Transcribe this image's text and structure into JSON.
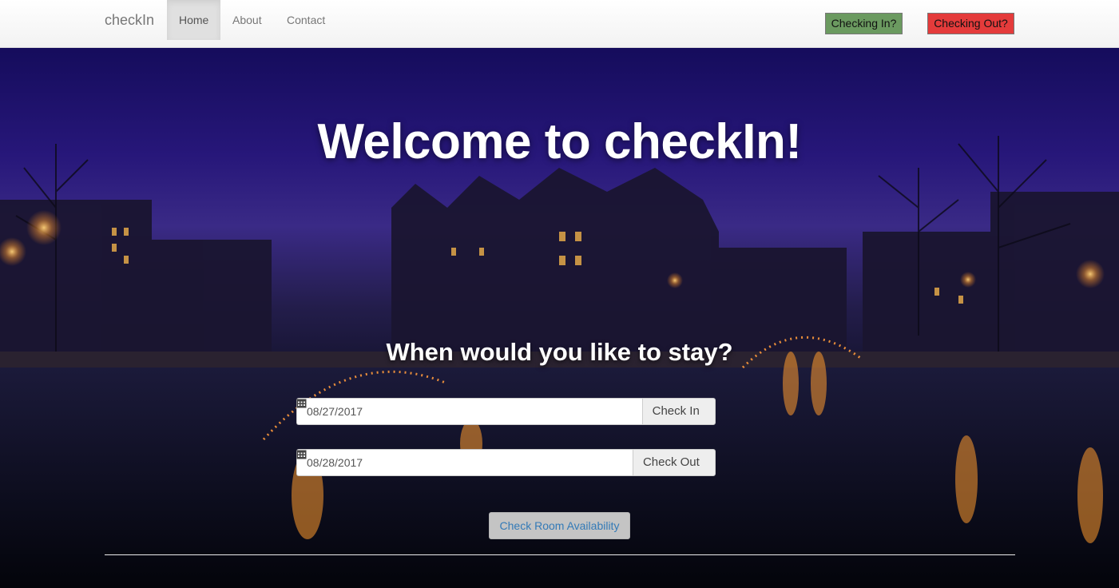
{
  "navbar": {
    "brand": "checkIn",
    "links": [
      {
        "label": "Home",
        "active": true
      },
      {
        "label": "About",
        "active": false
      },
      {
        "label": "Contact",
        "active": false
      }
    ],
    "checkin_button": "Checking In?",
    "checkout_button": "Checking Out?"
  },
  "hero": {
    "title": "Welcome to checkIn!",
    "subtitle": "When would you like to stay?",
    "checkin": {
      "value": "08/27/2017",
      "addon_label": "Check In",
      "icon": "calendar-icon"
    },
    "checkout": {
      "value": "08/28/2017",
      "addon_label": "Check Out",
      "icon": "calendar-icon"
    },
    "availability_button": "Check Room Availability"
  },
  "colors": {
    "checkin_button": "#6b9a60",
    "checkout_button": "#e43b3b",
    "link_blue": "#337ab7"
  }
}
